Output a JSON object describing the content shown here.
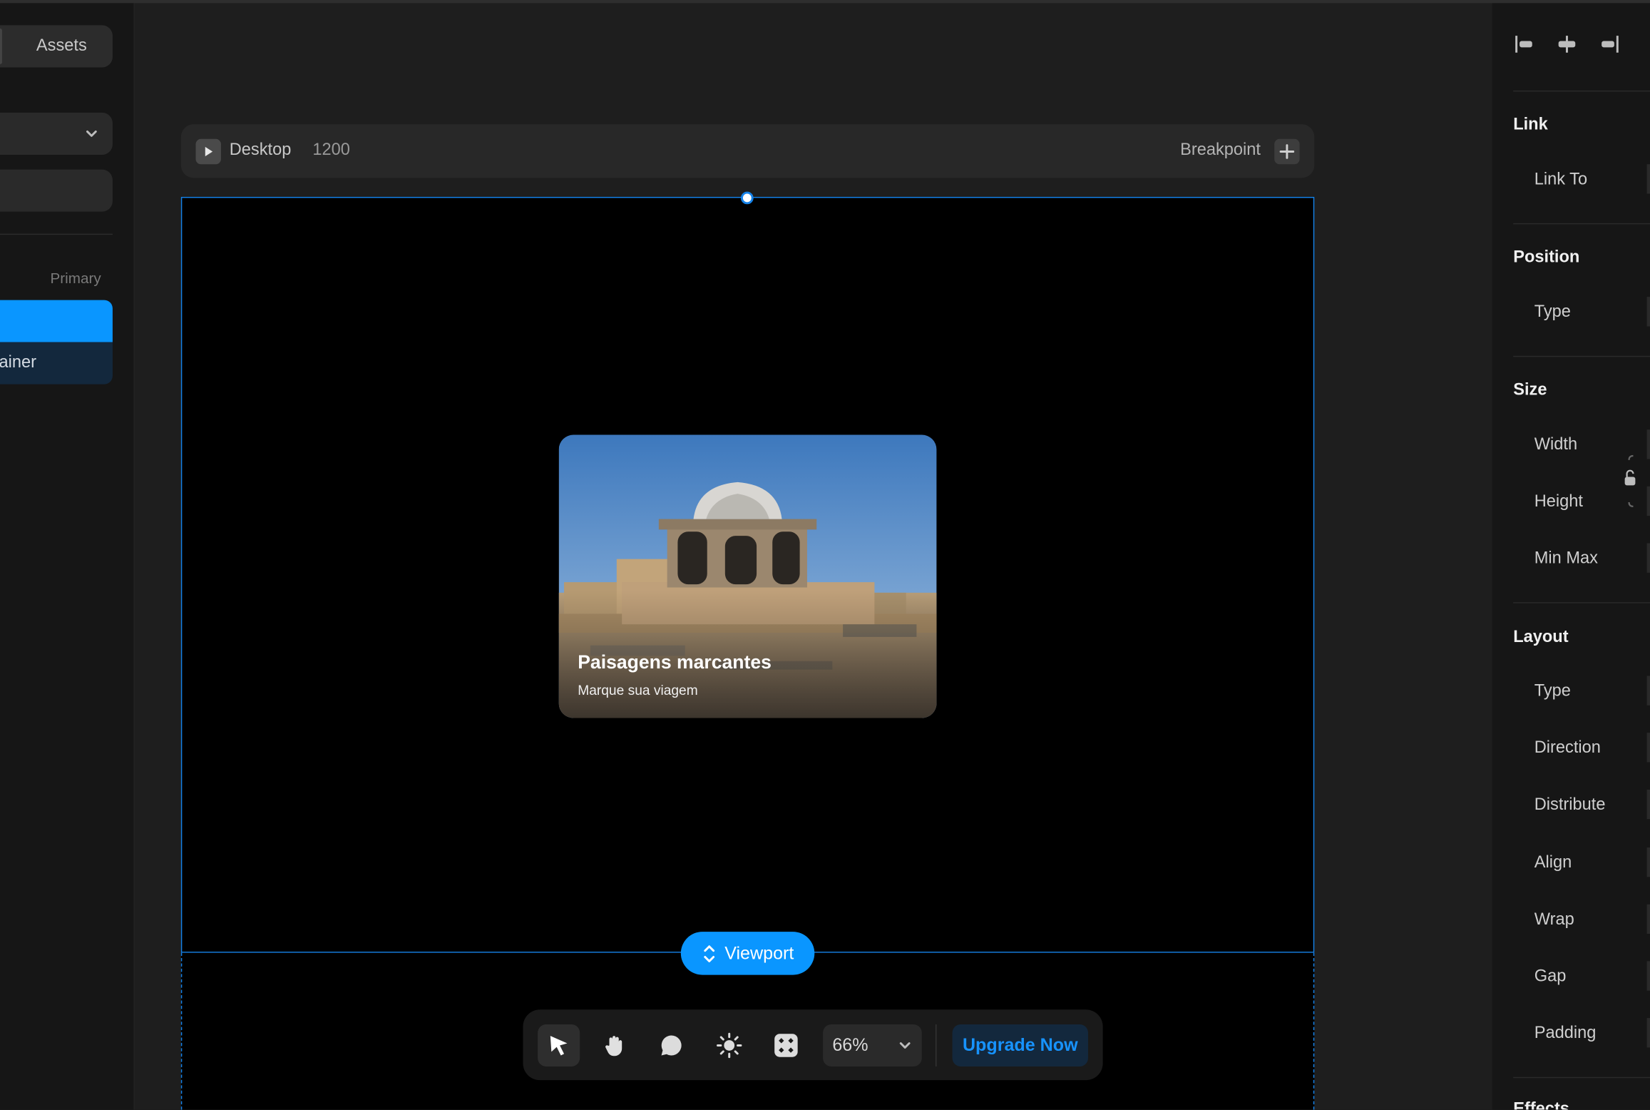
{
  "left_panel": {
    "assets_label": "Assets",
    "layers_group_label": "Primary",
    "layer_child_label": "ainer"
  },
  "breakpoint_bar": {
    "device_name": "Desktop",
    "device_width": "1200",
    "breakpoint_label": "Breakpoint"
  },
  "card": {
    "title": "Paisagens marcantes",
    "subtitle": "Marque sua viagem"
  },
  "viewport_label": "Viewport",
  "toolbar": {
    "zoom_value": "66%",
    "upgrade_label": "Upgrade Now"
  },
  "right_panel": {
    "link": {
      "title": "Link",
      "props": [
        "Link To"
      ]
    },
    "position": {
      "title": "Position",
      "props": [
        "Type"
      ]
    },
    "size": {
      "title": "Size",
      "props": [
        "Width",
        "Height",
        "Min Max"
      ]
    },
    "layout": {
      "title": "Layout",
      "props": [
        "Type",
        "Direction",
        "Distribute",
        "Align",
        "Wrap",
        "Gap",
        "Padding"
      ]
    },
    "effects": {
      "title": "Effects"
    }
  },
  "colors": {
    "accent": "#0a96ff",
    "selection_border": "#1582e8",
    "canvas_bg": "#000000",
    "panel_bg": "#161616"
  },
  "icons": {
    "tools": [
      "pointer-icon",
      "hand-icon",
      "comment-icon",
      "sun-icon",
      "components-icon"
    ]
  }
}
